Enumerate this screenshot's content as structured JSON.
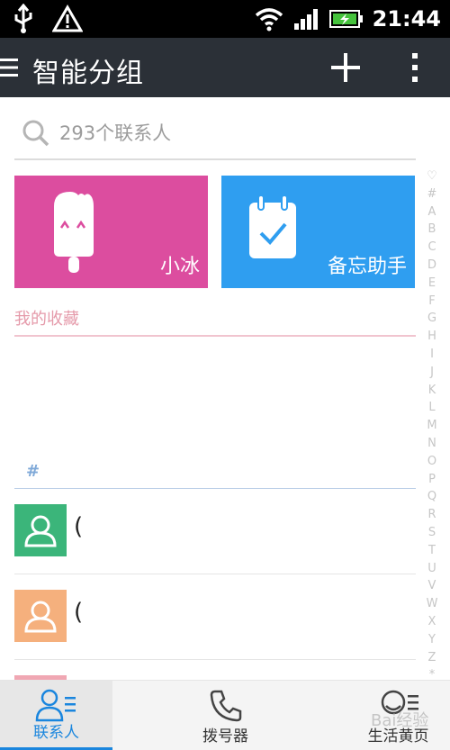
{
  "status_bar": {
    "time": "21:44",
    "icons": [
      "usb-icon",
      "warning-icon",
      "wifi-icon",
      "signal-icon",
      "battery-charging-icon"
    ]
  },
  "app_bar": {
    "title": "智能分组",
    "icons": [
      "menu-icon",
      "add-icon",
      "more-icon"
    ]
  },
  "search": {
    "placeholder": "293个联系人"
  },
  "tiles": [
    {
      "label": "小冰",
      "color": "#dc4d9f",
      "icon": "popsicle-icon"
    },
    {
      "label": "备忘助手",
      "color": "#2f9ef0",
      "icon": "calendar-check-icon"
    }
  ],
  "favorites": {
    "header": "我的收藏"
  },
  "section": {
    "header": "#"
  },
  "contacts": [
    {
      "avatar_color": "#3bb57a",
      "name": "("
    },
    {
      "avatar_color": "#f5b07d",
      "name": "("
    },
    {
      "avatar_color": "#f0a7b3",
      "name": ""
    }
  ],
  "index_bar": [
    "♡",
    "#",
    "A",
    "B",
    "C",
    "D",
    "E",
    "F",
    "G",
    "H",
    "I",
    "J",
    "K",
    "L",
    "M",
    "N",
    "O",
    "P",
    "Q",
    "R",
    "S",
    "T",
    "U",
    "V",
    "W",
    "X",
    "Y",
    "Z",
    "*"
  ],
  "bottom_nav": {
    "items": [
      {
        "label": "联系人",
        "icon": "contacts-icon",
        "active": true
      },
      {
        "label": "拨号器",
        "icon": "phone-icon",
        "active": false
      },
      {
        "label": "生活黄页",
        "icon": "yellow-pages-icon",
        "active": false
      }
    ]
  },
  "watermark": "Bai经验",
  "colors": {
    "app_bar": "#2b3037",
    "accent": "#1a86de",
    "favorites_header": "#e59aaa"
  }
}
